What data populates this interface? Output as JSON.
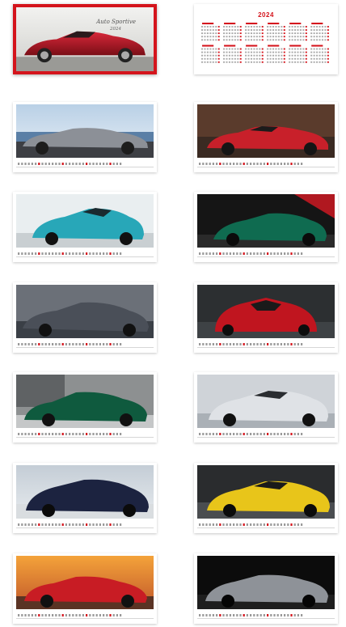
{
  "colors": {
    "accent": "#d4141c"
  },
  "cover": {
    "title": "Auto Sportive",
    "year": "2024"
  },
  "calendar_overview": {
    "year_title": "2024"
  },
  "cards": [
    {
      "label": "cover",
      "selected": true
    },
    {
      "label": "overview"
    },
    {
      "label": "month",
      "scene": "silver roadster by the sea"
    },
    {
      "label": "month",
      "scene": "red convertible sports car"
    },
    {
      "label": "month",
      "scene": "teal race car"
    },
    {
      "label": "month",
      "scene": "green sports car"
    },
    {
      "label": "month",
      "scene": "grey supercar"
    },
    {
      "label": "month",
      "scene": "red supercar front"
    },
    {
      "label": "month",
      "scene": "green sedan"
    },
    {
      "label": "month",
      "scene": "silver race coupe"
    },
    {
      "label": "month",
      "scene": "dark blue coupe"
    },
    {
      "label": "month",
      "scene": "yellow convertible"
    },
    {
      "label": "month",
      "scene": "red convertible at sunset"
    },
    {
      "label": "month",
      "scene": "silver roadster on dark"
    }
  ]
}
